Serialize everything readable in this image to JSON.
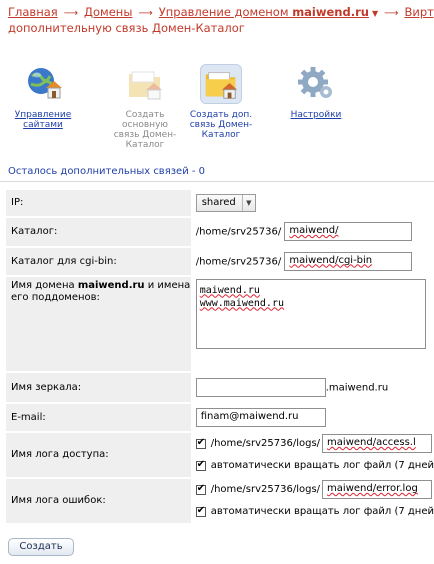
{
  "breadcrumb": {
    "home": "Главная",
    "domains": "Домены",
    "manage_prefix": "Управление доменом",
    "domain": "maiwend.ru",
    "virtual": "Вирту",
    "current": "дополнительную связь Домен-Каталог"
  },
  "toolbar": {
    "items": [
      {
        "label": "Управление сайтами",
        "state": "link",
        "icon": "globe-house-icon"
      },
      {
        "label": "Создать основную связь Домен-Каталог",
        "state": "disabled",
        "icon": "folder-house-icon"
      },
      {
        "label": "Создать доп. связь Домен-Каталог",
        "state": "selected",
        "icon": "folder-house-icon"
      },
      {
        "label": "Настройки",
        "state": "link",
        "icon": "gear-icon"
      }
    ]
  },
  "remaining": "Осталось дополнительных связей - 0",
  "form": {
    "ip_label": "IP:",
    "ip_value": "shared",
    "catalog_label": "Каталог:",
    "catalog_prefix": "/home/srv25736/",
    "catalog_value": "maiwend/",
    "cgi_label": "Каталог для cgi-bin:",
    "cgi_prefix": "/home/srv25736/",
    "cgi_value": "maiwend/cgi-bin",
    "domain_label_pre": "Имя домена",
    "domain_label_bold": "maiwend.ru",
    "domain_label_post": "и имена его поддоменов:",
    "domains_text_1": "maiwend.ru",
    "domains_text_2": "www.maiwend.ru",
    "mirror_label": "Имя зеркала:",
    "mirror_value": "",
    "mirror_suffix": ".maiwend.ru",
    "email_label": "E-mail:",
    "email_value": "finam@maiwend.ru",
    "access_log_label": "Имя лога доступа:",
    "access_log_prefix": "/home/srv25736/logs/",
    "access_log_value": "maiwend/access.l",
    "access_rotate": "автоматически вращать лог файл (7 дней",
    "error_log_label": "Имя лога ошибок:",
    "error_log_prefix": "/home/srv25736/logs/",
    "error_log_value": "maiwend/error.log",
    "error_rotate": "автоматически вращать лог файл (7 дней"
  },
  "submit_label": "Создать"
}
